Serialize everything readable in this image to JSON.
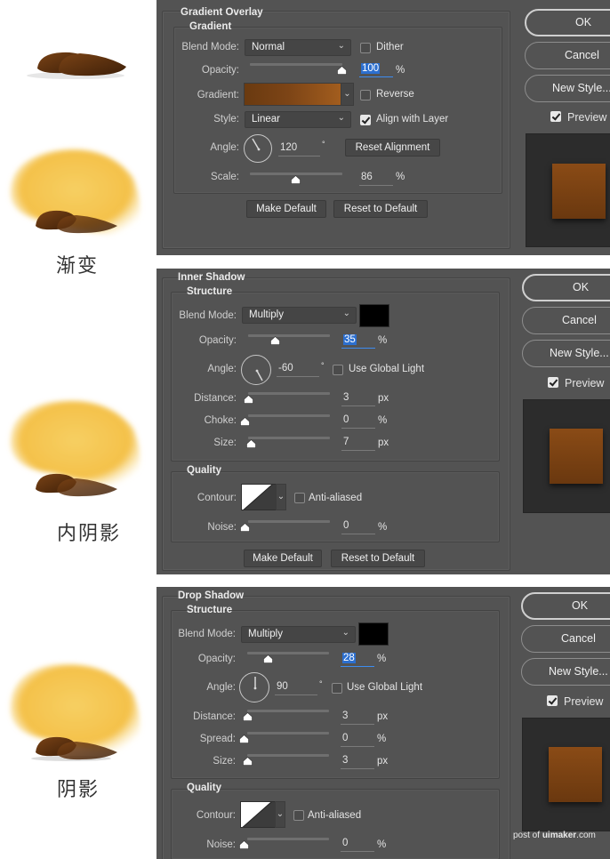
{
  "captions": {
    "gradient": "渐变",
    "inner_shadow": "内阴影",
    "drop_shadow": "阴影"
  },
  "common": {
    "ok": "OK",
    "cancel": "Cancel",
    "new_style": "New Style...",
    "preview": "Preview",
    "make_default": "Make Default",
    "reset_default": "Reset to Default",
    "blend_label": "Blend Mode:",
    "opacity_label": "Opacity:",
    "angle_label": "Angle:",
    "pct": "%",
    "px": "px",
    "deg": "°"
  },
  "gradient_overlay": {
    "title": "Gradient Overlay",
    "section": "Gradient",
    "blend_mode": "Normal",
    "dither_label": "Dither",
    "dither": false,
    "opacity": "100",
    "opacity_frac": 1.0,
    "gradient_label": "Gradient:",
    "gradient_colors": [
      "#6a3a10",
      "#a25d1e"
    ],
    "reverse_label": "Reverse",
    "reverse": false,
    "style_label": "Style:",
    "style": "Linear",
    "align_label": "Align with Layer",
    "align": true,
    "angle": "120",
    "reset_alignment": "Reset Alignment",
    "scale_label": "Scale:",
    "scale": "86",
    "scale_frac": 0.5
  },
  "inner_shadow": {
    "title": "Inner Shadow",
    "section": "Structure",
    "blend_mode": "Multiply",
    "color": "#000000",
    "opacity": "35",
    "opacity_frac": 0.35,
    "angle": "-60",
    "global_light_label": "Use Global Light",
    "global_light": false,
    "distance_label": "Distance:",
    "distance": "3",
    "choke_label": "Choke:",
    "choke": "0",
    "size_label": "Size:",
    "size": "7",
    "quality": "Quality",
    "contour_label": "Contour:",
    "anti_aliased_label": "Anti-aliased",
    "anti_aliased": false,
    "noise_label": "Noise:",
    "noise": "0"
  },
  "drop_shadow": {
    "title": "Drop Shadow",
    "section": "Structure",
    "blend_mode": "Multiply",
    "color": "#000000",
    "opacity": "28",
    "opacity_frac": 0.28,
    "angle": "90",
    "global_light_label": "Use Global Light",
    "global_light": false,
    "distance_label": "Distance:",
    "distance": "3",
    "spread_label": "Spread:",
    "spread": "0",
    "size_label": "Size:",
    "size": "3",
    "quality": "Quality",
    "contour_label": "Contour:",
    "anti_aliased_label": "Anti-aliased",
    "anti_aliased": false,
    "noise_label": "Noise:",
    "noise": "0"
  },
  "watermark": {
    "prefix": "post of ",
    "brand": "uimaker",
    "suffix": ".com"
  }
}
